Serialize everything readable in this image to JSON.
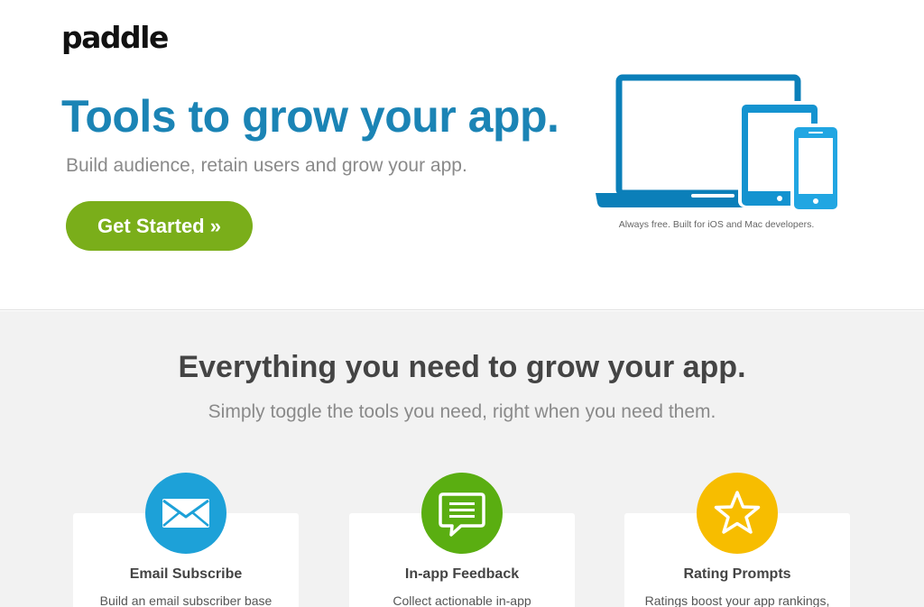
{
  "brand": {
    "logo_text": "paddle"
  },
  "hero": {
    "title": "Tools to grow your app.",
    "subtitle": "Build audience, retain users and grow your app.",
    "cta_label": "Get Started »",
    "devices_caption": "Always free. Built for iOS and Mac developers.",
    "devices_icon": "laptop-tablet-phone-icon"
  },
  "features": {
    "title": "Everything you need to grow your app.",
    "subtitle": "Simply toggle the tools you need, right when you need them.",
    "cards": [
      {
        "title": "Email Subscribe",
        "description": "Build an email subscriber base",
        "icon": "envelope-icon",
        "color": "#1da1d8"
      },
      {
        "title": "In-app Feedback",
        "description": "Collect actionable in-app",
        "icon": "chat-bubble-icon",
        "color": "#5aae11"
      },
      {
        "title": "Rating Prompts",
        "description": "Ratings boost your app rankings,",
        "icon": "star-icon",
        "color": "#f7bd00"
      }
    ]
  },
  "colors": {
    "title_blue": "#1b84b5",
    "cta_green": "#7aae1a",
    "device_blue": "#0b8dc7",
    "section_bg": "#f2f2f2"
  }
}
